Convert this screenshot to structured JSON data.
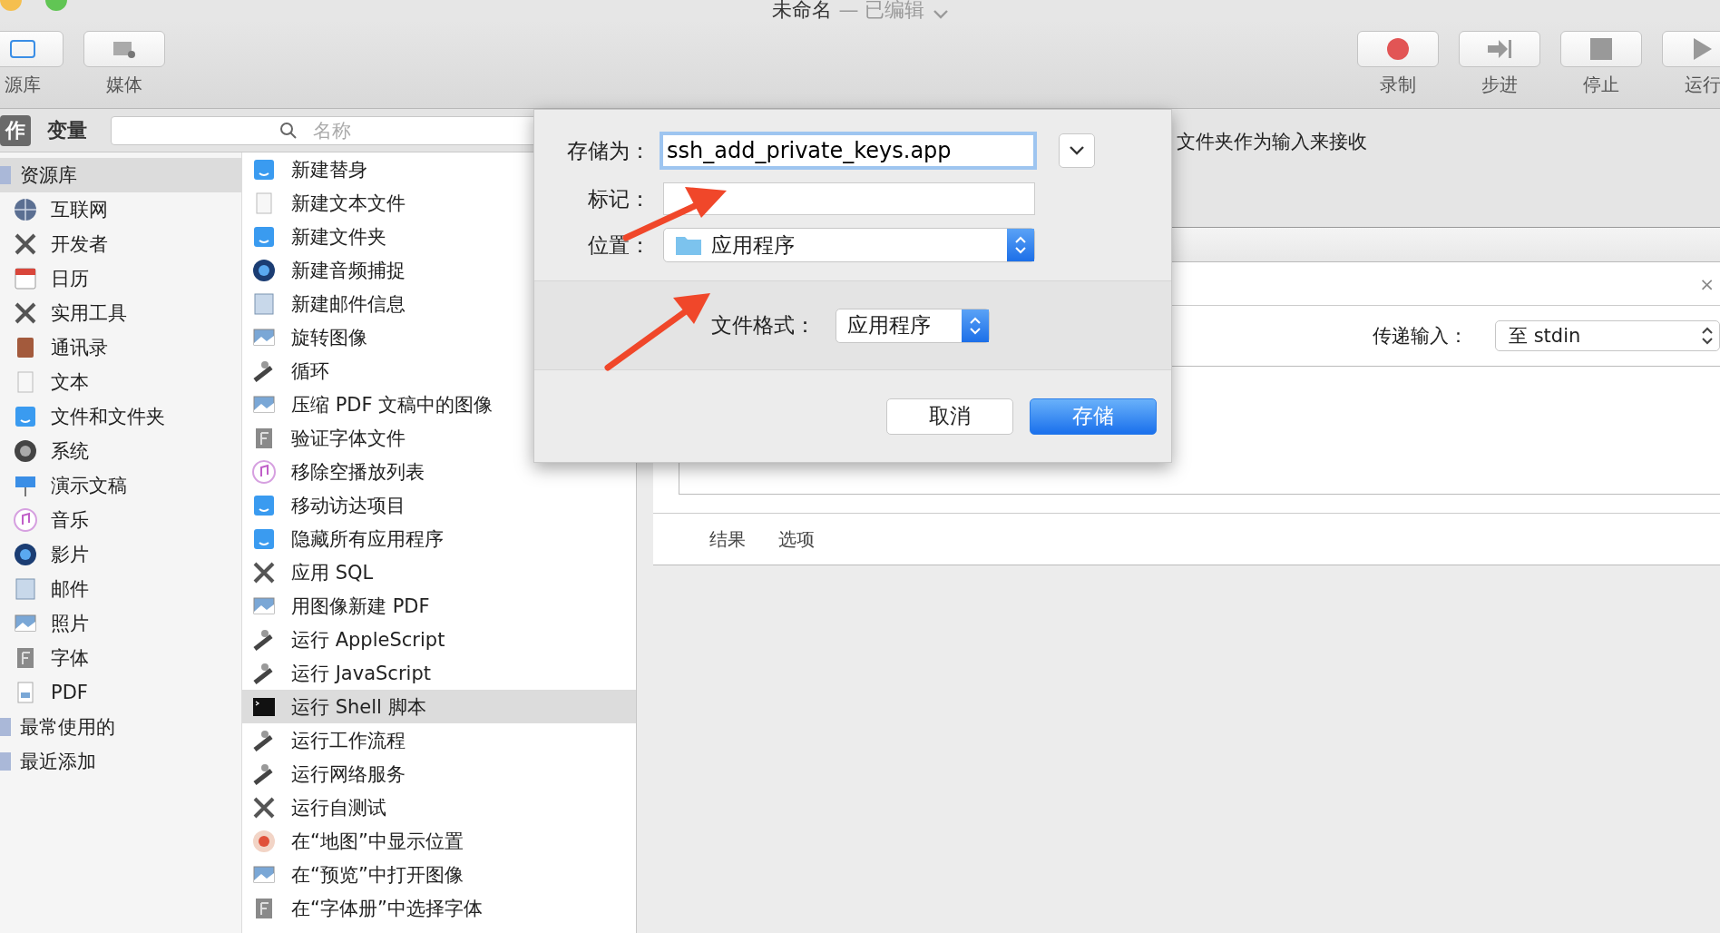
{
  "window": {
    "title": "未命名",
    "subtitle": "— 已编辑"
  },
  "toolbar": {
    "left": [
      {
        "label": "源库"
      },
      {
        "label": "媒体"
      }
    ],
    "right": [
      {
        "label": "录制"
      },
      {
        "label": "步进"
      },
      {
        "label": "停止"
      },
      {
        "label": "运行"
      }
    ]
  },
  "library": {
    "tabs": [
      {
        "label": "作",
        "selected": true
      },
      {
        "label": "变量",
        "selected": false
      }
    ],
    "search": {
      "placeholder": "名称"
    },
    "sidebar": [
      {
        "label": "资源库",
        "selected": true,
        "children": [
          {
            "label": "互联网"
          },
          {
            "label": "开发者"
          },
          {
            "label": "日历"
          },
          {
            "label": "实用工具"
          },
          {
            "label": "通讯录"
          },
          {
            "label": "文本"
          },
          {
            "label": "文件和文件夹"
          },
          {
            "label": "系统"
          },
          {
            "label": "演示文稿"
          },
          {
            "label": "音乐"
          },
          {
            "label": "影片"
          },
          {
            "label": "邮件"
          },
          {
            "label": "照片"
          },
          {
            "label": "字体"
          },
          {
            "label": "PDF"
          }
        ]
      },
      {
        "label": "最常使用的",
        "selected": false
      },
      {
        "label": "最近添加",
        "selected": false
      }
    ],
    "actions": [
      {
        "label": "新建替身",
        "selected": false
      },
      {
        "label": "新建文本文件",
        "selected": false
      },
      {
        "label": "新建文件夹",
        "selected": false
      },
      {
        "label": "新建音频捕捉",
        "selected": false
      },
      {
        "label": "新建邮件信息",
        "selected": false
      },
      {
        "label": "旋转图像",
        "selected": false
      },
      {
        "label": "循环",
        "selected": false
      },
      {
        "label": "压缩 PDF 文稿中的图像",
        "selected": false
      },
      {
        "label": "验证字体文件",
        "selected": false
      },
      {
        "label": "移除空播放列表",
        "selected": false
      },
      {
        "label": "移动访达项目",
        "selected": false
      },
      {
        "label": "隐藏所有应用程序",
        "selected": false
      },
      {
        "label": "应用 SQL",
        "selected": false
      },
      {
        "label": "用图像新建 PDF",
        "selected": false
      },
      {
        "label": "运行 AppleScript",
        "selected": false
      },
      {
        "label": "运行 JavaScript",
        "selected": false
      },
      {
        "label": "运行 Shell 脚本",
        "selected": true
      },
      {
        "label": "运行工作流程",
        "selected": false
      },
      {
        "label": "运行网络服务",
        "selected": false
      },
      {
        "label": "运行自测试",
        "selected": false
      },
      {
        "label": "在“地图”中显示位置",
        "selected": false
      },
      {
        "label": "在“预览”中打开图像",
        "selected": false
      },
      {
        "label": "在“字体册”中选择字体",
        "selected": false
      }
    ]
  },
  "workflow": {
    "hint": "文件夹作为输入来接收",
    "action": {
      "close": "×",
      "pass_input_label": "传递输入：",
      "pass_input_value": "至 stdin",
      "tabs": [
        {
          "label": "结果"
        },
        {
          "label": "选项"
        }
      ]
    }
  },
  "save_dialog": {
    "save_as_label": "存储为：",
    "filename": "ssh_add_private_keys.app",
    "tags_label": "标记：",
    "location_label": "位置：",
    "location": "应用程序",
    "format_label": "文件格式：",
    "format": "应用程序",
    "buttons": [
      {
        "label": "取消",
        "kind": "secondary"
      },
      {
        "label": "存储",
        "kind": "primary"
      }
    ]
  }
}
